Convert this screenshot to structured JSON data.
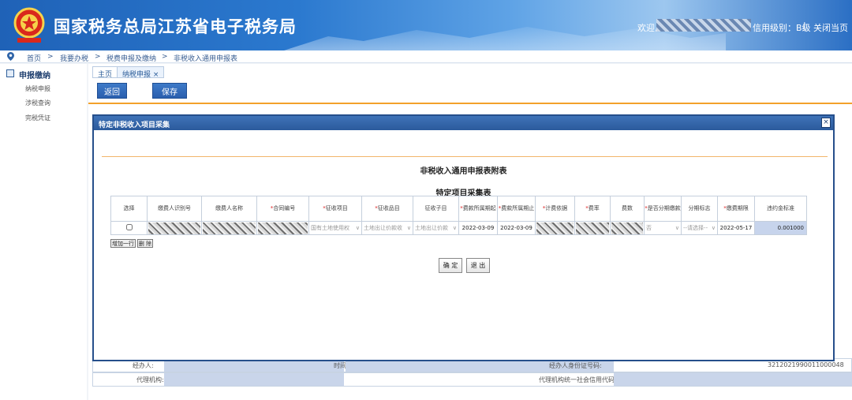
{
  "header": {
    "title": "国家税务总局江苏省电子税务局",
    "welcome": "欢迎,",
    "credit": "信用级别：B级",
    "sep": "|",
    "close": "关闭当页"
  },
  "breadcrumb": {
    "items": [
      "首页",
      ">",
      "我要办税",
      ">",
      "税费申报及缴纳",
      ">",
      "非税收入通用申报表"
    ]
  },
  "sidebar": {
    "head": "申报缴纳",
    "items": [
      "纳税申报",
      "涉税查询",
      "完税凭证"
    ]
  },
  "tabs": [
    {
      "label": "主页"
    },
    {
      "label": "纳税申报 ×"
    }
  ],
  "toolbar": {
    "back": "返回",
    "save": "保存"
  },
  "background": {
    "row1_left": "经办人:",
    "row1_mid": "时间",
    "row1_right": "经办人身份证号码:",
    "row1_value": "3212021990011000048",
    "row2_left": "代理机构:",
    "row2_right": "代理机构统一社会信用代码:"
  },
  "modal": {
    "title": "特定非税收入项目采集",
    "close": "×",
    "annex_title": "非税收入通用申报表附表",
    "table_title": "特定项目采集表",
    "columns": [
      {
        "label": "选择",
        "req": false
      },
      {
        "label": "缴费人识别号",
        "req": false
      },
      {
        "label": "缴费人名称",
        "req": false
      },
      {
        "label": "合同编号",
        "req": true
      },
      {
        "label": "征收项目",
        "req": true
      },
      {
        "label": "征收品目",
        "req": true
      },
      {
        "label": "征收子目",
        "req": false
      },
      {
        "label": "费款所属期起",
        "req": true
      },
      {
        "label": "费款所属期止",
        "req": true
      },
      {
        "label": "计费依据",
        "req": true
      },
      {
        "label": "费率",
        "req": true
      },
      {
        "label": "费数",
        "req": false
      },
      {
        "label": "是否分期缴款",
        "req": true
      },
      {
        "label": "分期标志",
        "req": false
      },
      {
        "label": "缴费期限",
        "req": true
      },
      {
        "label": "违约金标准",
        "req": false
      }
    ],
    "row": {
      "project": "国有土地使用权",
      "item": "土地出让价款收",
      "subitem": "土地出让价款",
      "period_start": "2022-03-09",
      "period_end": "2022-03-09",
      "installment": "否",
      "installment_flag": "--请选择--",
      "deadline": "2022-05-17",
      "penalty": "0.001000"
    },
    "add_row": "增加一行",
    "delete": "删 除",
    "confirm": "确 定",
    "exit": "退 出"
  },
  "colors": {
    "header_blue": "#2b79cf",
    "accent_orange": "#f3a12a",
    "button_blue": "#2a5fae"
  }
}
